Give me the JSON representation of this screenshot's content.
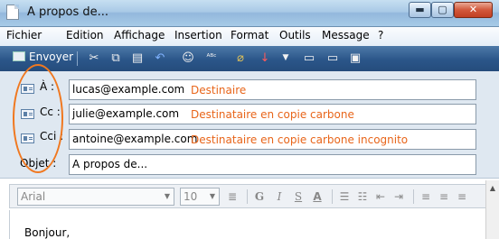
{
  "window": {
    "title": "A propos de...",
    "min": "▬",
    "max": "▢",
    "close": "✕"
  },
  "menu": [
    "Fichier",
    "Edition",
    "Affichage",
    "Insertion",
    "Format",
    "Outils",
    "Message",
    "?"
  ],
  "toolbar": {
    "send": "Envoyer"
  },
  "fields": {
    "to": {
      "label": "À :",
      "value": "lucas@example.com",
      "note": "Destinaire"
    },
    "cc": {
      "label": "Cc :",
      "value": "julie@example.com",
      "note": "Destinataire en copie carbone"
    },
    "bcc": {
      "label": "Cci :",
      "value": "antoine@example.com",
      "note": "Destinataire en copie carbone incognito"
    },
    "subject": {
      "label": "Objet :",
      "value": "A propos de..."
    }
  },
  "format": {
    "font": "Arial",
    "size": "10"
  },
  "body": {
    "text": "Bonjour,"
  },
  "colors": {
    "annotation": "#e8651a",
    "toolbar": "#2b5689"
  }
}
